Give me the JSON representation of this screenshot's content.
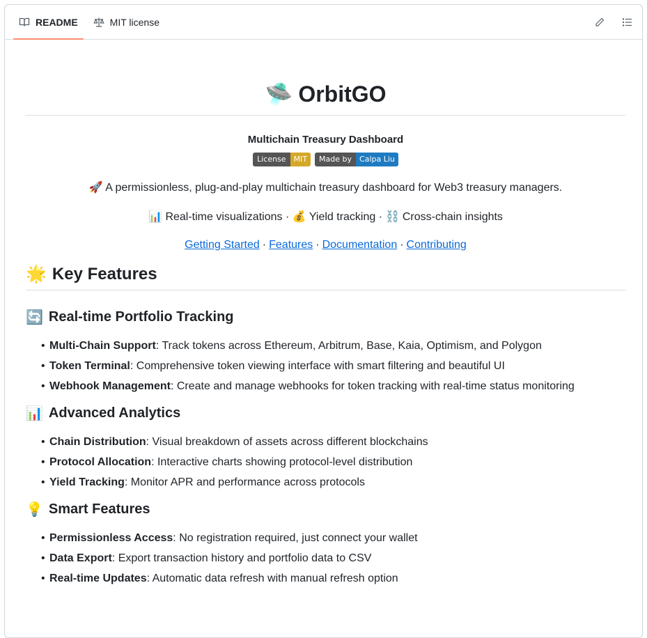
{
  "tabs": [
    {
      "label": "README",
      "icon": "book-icon"
    },
    {
      "label": "MIT license",
      "icon": "scale-icon"
    }
  ],
  "tools": {
    "edit_icon": "pencil-icon",
    "outline_icon": "list-icon"
  },
  "readme": {
    "title": "OrbitGO",
    "title_emoji": "🛸",
    "subtitle": "Multichain Treasury Dashboard",
    "badges": [
      {
        "left": "License",
        "right": "MIT",
        "color": "#d6a82a"
      },
      {
        "left": "Made by",
        "right": "Calpa Liu",
        "color": "#1f7bc1"
      }
    ],
    "tagline_emoji": "🚀",
    "tagline": "A permissionless, plug-and-play multichain treasury dashboard for Web3 treasury managers.",
    "highlights": [
      {
        "emoji": "📊",
        "text": "Real-time visualizations"
      },
      {
        "emoji": "💰",
        "text": "Yield tracking"
      },
      {
        "emoji": "⛓️",
        "text": "Cross-chain insights"
      }
    ],
    "links": [
      "Getting Started",
      "Features",
      "Documentation",
      "Contributing"
    ],
    "key_features": {
      "emoji": "🌟",
      "heading": "Key Features",
      "sections": [
        {
          "emoji": "🔄",
          "heading": "Real-time Portfolio Tracking",
          "items": [
            {
              "bold": "Multi-Chain Support",
              "text": ": Track tokens across Ethereum, Arbitrum, Base, Kaia, Optimism, and Polygon"
            },
            {
              "bold": "Token Terminal",
              "text": ": Comprehensive token viewing interface with smart filtering and beautiful UI"
            },
            {
              "bold": "Webhook Management",
              "text": ": Create and manage webhooks for token tracking with real-time status monitoring"
            }
          ]
        },
        {
          "emoji": "📊",
          "heading": "Advanced Analytics",
          "items": [
            {
              "bold": "Chain Distribution",
              "text": ": Visual breakdown of assets across different blockchains"
            },
            {
              "bold": "Protocol Allocation",
              "text": ": Interactive charts showing protocol-level distribution"
            },
            {
              "bold": "Yield Tracking",
              "text": ": Monitor APR and performance across protocols"
            }
          ]
        },
        {
          "emoji": "💡",
          "heading": "Smart Features",
          "items": [
            {
              "bold": "Permissionless Access",
              "text": ": No registration required, just connect your wallet"
            },
            {
              "bold": "Data Export",
              "text": ": Export transaction history and portfolio data to CSV"
            },
            {
              "bold": "Real-time Updates",
              "text": ": Automatic data refresh with manual refresh option"
            }
          ]
        }
      ]
    }
  }
}
